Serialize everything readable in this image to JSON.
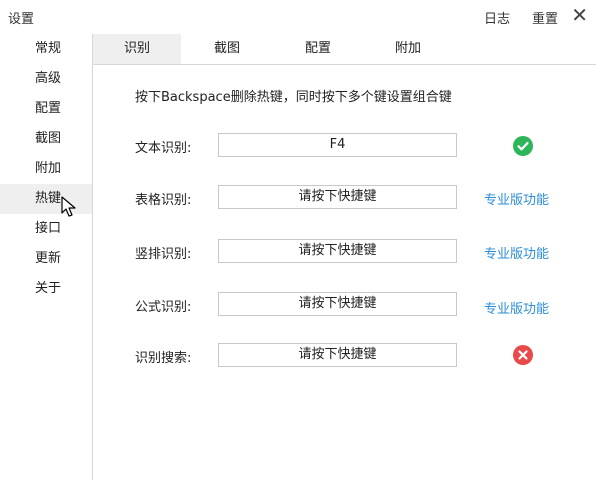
{
  "window": {
    "title": "设置",
    "log_label": "日志",
    "reset_label": "重置",
    "close_glyph": "✕"
  },
  "sidebar": {
    "items": [
      {
        "label": "常规"
      },
      {
        "label": "高级"
      },
      {
        "label": "配置"
      },
      {
        "label": "截图"
      },
      {
        "label": "附加"
      },
      {
        "label": "热键"
      },
      {
        "label": "接口"
      },
      {
        "label": "更新"
      },
      {
        "label": "关于"
      }
    ],
    "active_index": 5
  },
  "tabs": [
    {
      "label": "识别"
    },
    {
      "label": "截图"
    },
    {
      "label": "配置"
    },
    {
      "label": "附加"
    }
  ],
  "active_tab": 0,
  "hint": "按下Backspace删除热键，同时按下多个键设置组合键",
  "rows": [
    {
      "label": "文本识别:",
      "value": "F4",
      "status": "check-icon",
      "status_color": "#2eb55a"
    },
    {
      "label": "表格识别:",
      "value": "请按下快捷键",
      "pro": "专业版功能"
    },
    {
      "label": "竖排识别:",
      "value": "请按下快捷键",
      "pro": "专业版功能"
    },
    {
      "label": "公式识别:",
      "value": "请按下快捷键",
      "pro": "专业版功能"
    },
    {
      "label": "识别搜索:",
      "value": "请按下快捷键",
      "status": "error-icon",
      "status_color": "#e84a4a"
    }
  ],
  "colors": {
    "link": "#2c8ed6",
    "active_bg": "#efefef",
    "divider": "#d6d6d6"
  }
}
